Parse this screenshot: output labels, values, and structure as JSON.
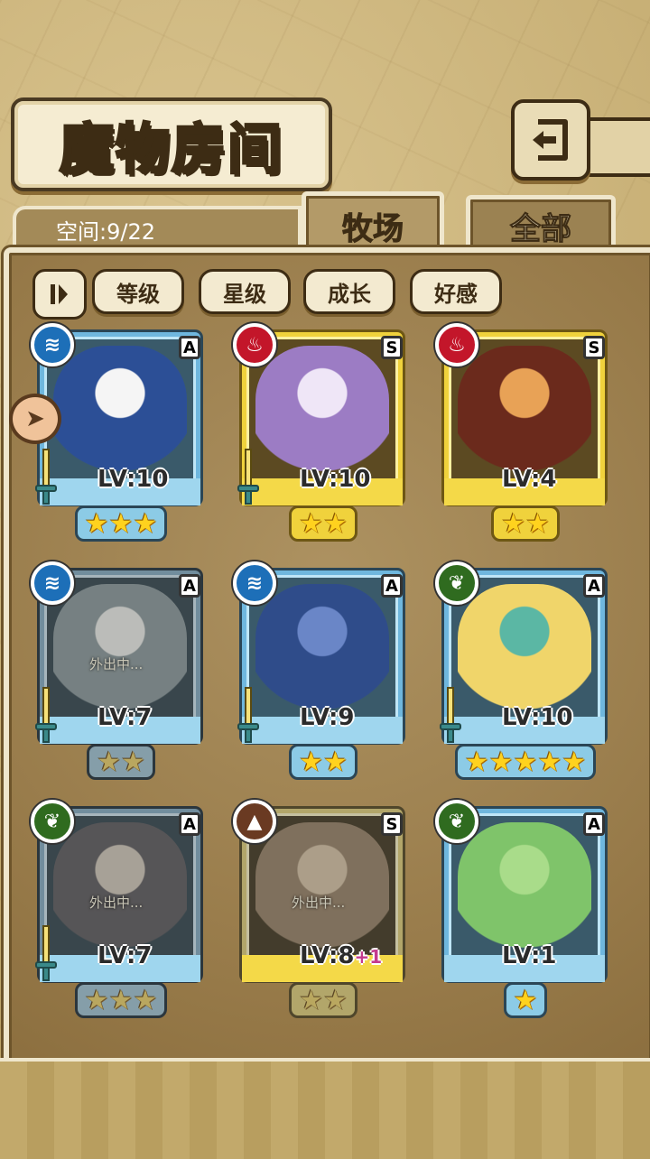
{
  "header": {
    "title": "魔物房间",
    "back_icon": "back-arrow-icon"
  },
  "tabs": {
    "space_label": "空间:9/22",
    "ranch": "牧场",
    "all": "全部"
  },
  "sort": {
    "level": "等级",
    "star": "星级",
    "growth": "成长",
    "affection": "好感"
  },
  "cards": [
    {
      "element": "water",
      "rank": "A",
      "level": "LV:10",
      "stars": 3,
      "away": "",
      "plus": "",
      "colors": [
        "#2c4f96",
        "#f5f5f5"
      ]
    },
    {
      "element": "fire",
      "rank": "S",
      "level": "LV:10",
      "stars": 2,
      "away": "",
      "plus": "",
      "colors": [
        "#9c7cc4",
        "#efe6f7"
      ]
    },
    {
      "element": "fire",
      "rank": "S",
      "level": "LV:4",
      "stars": 2,
      "away": "",
      "plus": "",
      "colors": [
        "#6b2a1c",
        "#e8a256"
      ]
    },
    {
      "element": "water",
      "rank": "A",
      "level": "LV:7",
      "stars": 2,
      "away": "外出中...",
      "plus": "",
      "colors": [
        "#8aa3a6",
        "#e8ece4"
      ]
    },
    {
      "element": "water",
      "rank": "A",
      "level": "LV:9",
      "stars": 2,
      "away": "",
      "plus": "",
      "colors": [
        "#2f4c8a",
        "#6a86c7"
      ]
    },
    {
      "element": "grass",
      "rank": "A",
      "level": "LV:10",
      "stars": 5,
      "away": "",
      "plus": "",
      "colors": [
        "#f0d56a",
        "#5bb7a4"
      ]
    },
    {
      "element": "grass",
      "rank": "A",
      "level": "LV:7",
      "stars": 3,
      "away": "外出中...",
      "plus": "",
      "colors": [
        "#6d6a6e",
        "#d8c8b0"
      ]
    },
    {
      "element": "earth",
      "rank": "S",
      "level": "LV:8",
      "stars": 2,
      "away": "外出中...",
      "plus": "+1",
      "colors": [
        "#b08a5a",
        "#e6c48e"
      ]
    },
    {
      "element": "grass",
      "rank": "A",
      "level": "LV:1",
      "stars": 1,
      "away": "",
      "plus": "",
      "colors": [
        "#7fc46a",
        "#a9dc8a"
      ]
    }
  ],
  "icons": {
    "water": "≋",
    "fire": "♨",
    "grass": "❦",
    "earth": "▲"
  }
}
